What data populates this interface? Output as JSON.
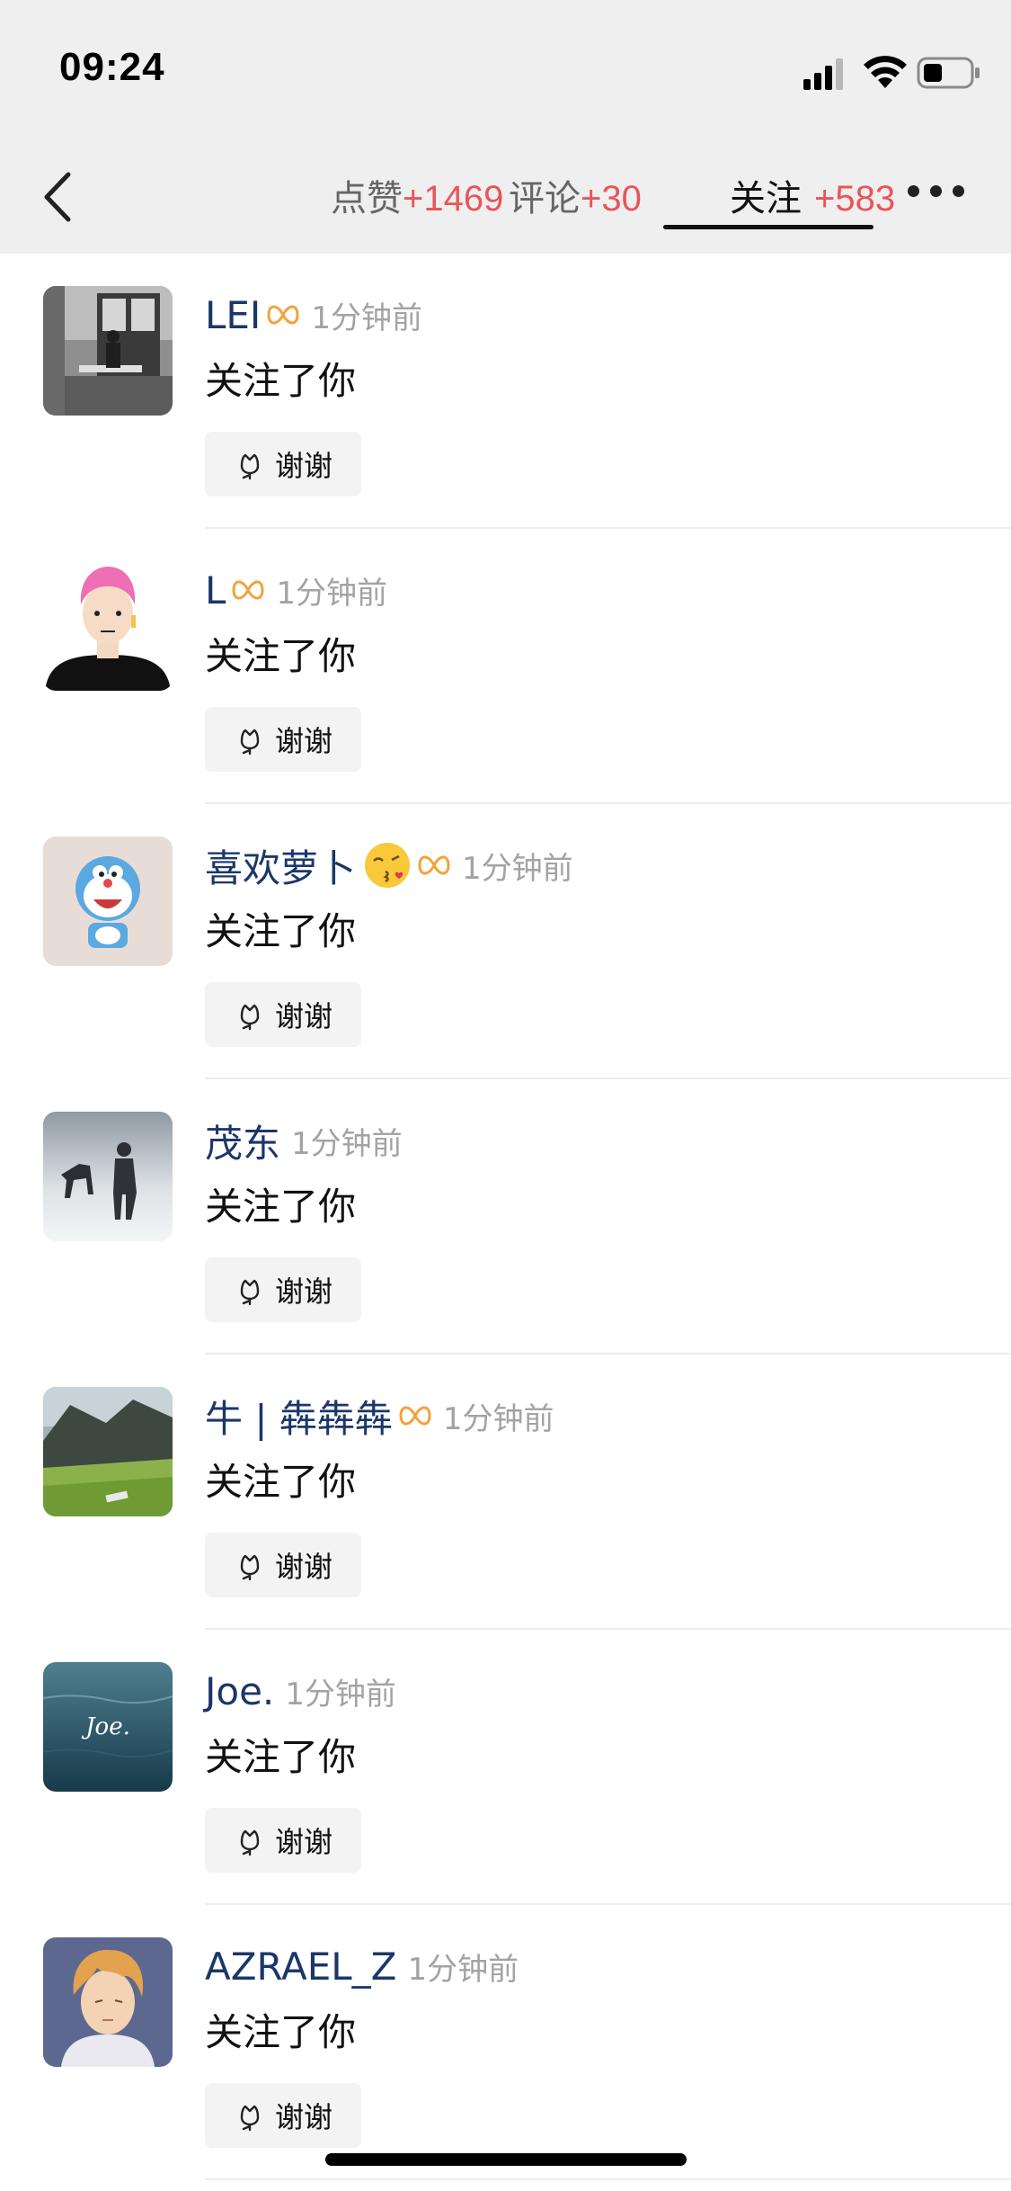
{
  "status_bar": {
    "time": "09:24"
  },
  "tabs": [
    {
      "label": "点赞",
      "count": "+1469"
    },
    {
      "label": "评论",
      "count": "+30"
    },
    {
      "label": "关注",
      "count": "+583"
    }
  ],
  "thanks_label": "谢谢",
  "items": [
    {
      "name": "LEI",
      "time": "1分钟前",
      "action": "关注了你"
    },
    {
      "name": "L",
      "time": "1分钟前",
      "action": "关注了你"
    },
    {
      "name": "喜欢萝卜",
      "time": "1分钟前",
      "action": "关注了你"
    },
    {
      "name": "茂东",
      "time": "1分钟前",
      "action": "关注了你"
    },
    {
      "name": "牛 | 犇犇犇",
      "time": "1分钟前",
      "action": "关注了你"
    },
    {
      "name": "Joe.",
      "time": "1分钟前",
      "action": "关注了你",
      "avatar_text": "Joe."
    },
    {
      "name": "AZRAEL_Z",
      "time": "1分钟前",
      "action": "关注了你"
    }
  ],
  "icons": [
    "back-icon",
    "signal-icon",
    "wifi-icon",
    "battery-icon",
    "more-icon",
    "vip-badge-icon",
    "kiss-emoji-icon",
    "flower-icon"
  ],
  "colors": {
    "username": "#1b3768",
    "count": "#e9545a",
    "vip": "#f2a33a",
    "timestamp": "#a3a3a3"
  }
}
